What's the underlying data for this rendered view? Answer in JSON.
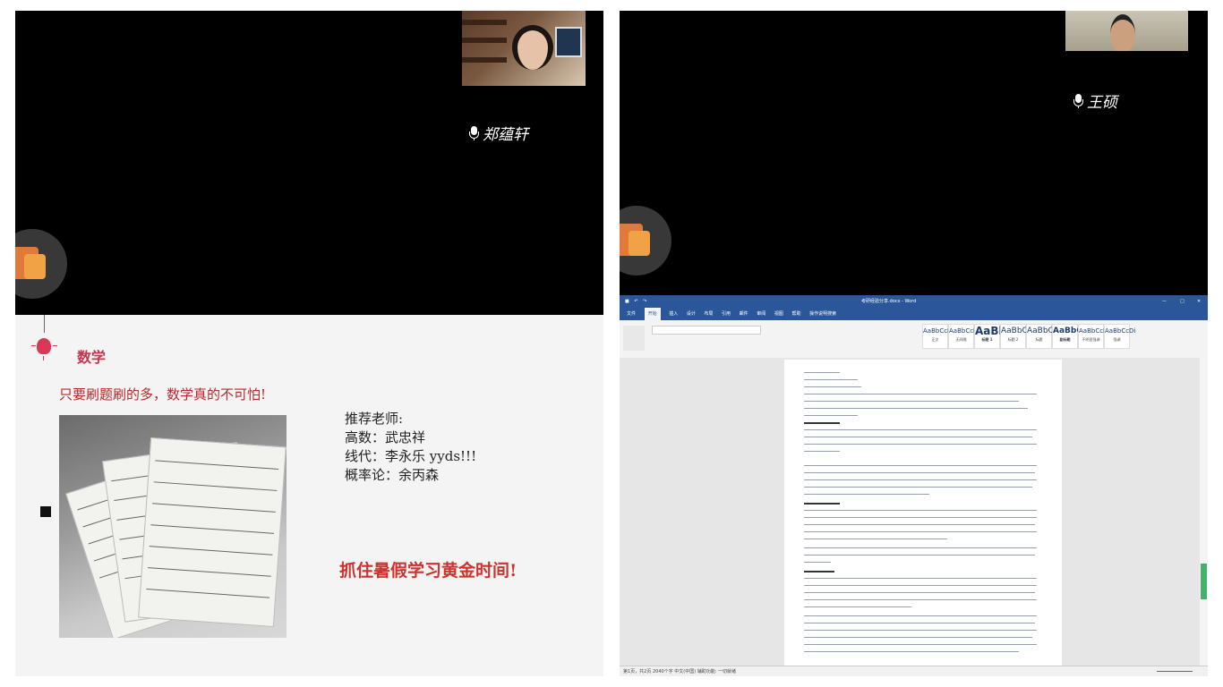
{
  "left_panel": {
    "participant_name": "郑蕴轩",
    "slide": {
      "title": "数学",
      "subtitle": "只要刷题刷的多，数学真的不可怕!",
      "recommend_heading": "推荐老师:",
      "teachers": [
        "高数：武忠祥",
        "线代：李永乐 yyds!!!",
        "概率论：余丙森"
      ],
      "slogan": "抓住暑假学习黄金时间!"
    }
  },
  "right_panel": {
    "participant_name": "王硕",
    "word": {
      "window_title": "考研经验分享.docx - Word",
      "tabs": [
        "文件",
        "开始",
        "插入",
        "设计",
        "布局",
        "引用",
        "邮件",
        "审阅",
        "视图",
        "帮助",
        "操作说明搜索"
      ],
      "active_tab": "开始",
      "styles": [
        {
          "sample": "AaBbCcDi",
          "name": "正文"
        },
        {
          "sample": "AaBbCcDi",
          "name": "无间隔"
        },
        {
          "sample": "AaBl",
          "name": "标题 1"
        },
        {
          "sample": "AaBbC",
          "name": "标题 2"
        },
        {
          "sample": "AaBbC",
          "name": "标题"
        },
        {
          "sample": "AaBbC",
          "name": "副标题"
        },
        {
          "sample": "AaBbCcDi",
          "name": "不明显强调"
        },
        {
          "sample": "AaBbCcDi",
          "name": "强调"
        }
      ],
      "doc_lines": [
        "姓名：王硕",
        "院校：19 级水管理本",
        "专业：园林与环境景观系统",
        "关于择校择专业：",
        "关于备考时间：",
        "关于数学："
      ],
      "status_text": "第1页，共2页  2040个字  中文(中国)  辅助功能: 一切就绪"
    }
  },
  "colors": {
    "slide_accent": "#c4354f",
    "slogan_red": "#d0312d",
    "word_blue": "#2b579a"
  }
}
